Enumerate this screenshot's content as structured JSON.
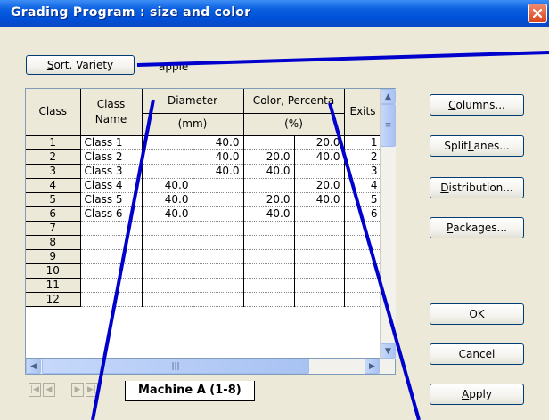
{
  "window": {
    "title": "Grading Program : size and color"
  },
  "toolbar": {
    "sort_variety_label": "Sort, Variety",
    "variety_value": "apple"
  },
  "grid": {
    "headers": {
      "class": "Class",
      "class_name_1": "Class",
      "class_name_2": "Name",
      "diameter": "Diameter",
      "diameter_unit": "(mm)",
      "color": "Color, Percenta",
      "color_unit": "(%)",
      "exits": "Exits"
    },
    "rows": [
      {
        "cls": "1",
        "name": "Class 1",
        "d1": "",
        "d2": "40.0",
        "c1": "",
        "c2": "20.0",
        "exits": "1"
      },
      {
        "cls": "2",
        "name": "Class 2",
        "d1": "",
        "d2": "40.0",
        "c1": "20.0",
        "c2": "40.0",
        "exits": "2"
      },
      {
        "cls": "3",
        "name": "Class 3",
        "d1": "",
        "d2": "40.0",
        "c1": "40.0",
        "c2": "",
        "exits": "3"
      },
      {
        "cls": "4",
        "name": "Class 4",
        "d1": "40.0",
        "d2": "",
        "c1": "",
        "c2": "20.0",
        "exits": "4"
      },
      {
        "cls": "5",
        "name": "Class 5",
        "d1": "40.0",
        "d2": "",
        "c1": "20.0",
        "c2": "40.0",
        "exits": "5"
      },
      {
        "cls": "6",
        "name": "Class 6",
        "d1": "40.0",
        "d2": "",
        "c1": "40.0",
        "c2": "",
        "exits": "6"
      },
      {
        "cls": "7",
        "name": "",
        "d1": "",
        "d2": "",
        "c1": "",
        "c2": "",
        "exits": ""
      },
      {
        "cls": "8",
        "name": "",
        "d1": "",
        "d2": "",
        "c1": "",
        "c2": "",
        "exits": ""
      },
      {
        "cls": "9",
        "name": "",
        "d1": "",
        "d2": "",
        "c1": "",
        "c2": "",
        "exits": ""
      },
      {
        "cls": "10",
        "name": "",
        "d1": "",
        "d2": "",
        "c1": "",
        "c2": "",
        "exits": ""
      },
      {
        "cls": "11",
        "name": "",
        "d1": "",
        "d2": "",
        "c1": "",
        "c2": "",
        "exits": ""
      },
      {
        "cls": "12",
        "name": "",
        "d1": "",
        "d2": "",
        "c1": "",
        "c2": "",
        "exits": ""
      }
    ],
    "sheet_tab": "Machine A (1-8)"
  },
  "buttons": {
    "columns": {
      "pre": "",
      "u": "C",
      "post": "olumns..."
    },
    "split_lanes": {
      "pre": "Split ",
      "u": "L",
      "post": "anes..."
    },
    "distribution": {
      "pre": "",
      "u": "D",
      "post": "istribution..."
    },
    "packages": {
      "pre": "",
      "u": "P",
      "post": "ackages..."
    },
    "ok": "OK",
    "cancel": "Cancel",
    "apply": {
      "pre": "",
      "u": "A",
      "post": "pply"
    }
  },
  "sort_button_parts": {
    "pre": "",
    "u": "S",
    "post": "ort, Variety"
  },
  "icons": {
    "close": "close-x-icon",
    "scroll_up": "arrow-up-icon",
    "scroll_down": "arrow-down-icon",
    "scroll_left": "arrow-left-icon",
    "scroll_right": "arrow-right-icon"
  },
  "colors": {
    "titlebar": "#0050d8",
    "annotation_lines": "#0000cc",
    "dialog_bg": "#ece9d8"
  }
}
